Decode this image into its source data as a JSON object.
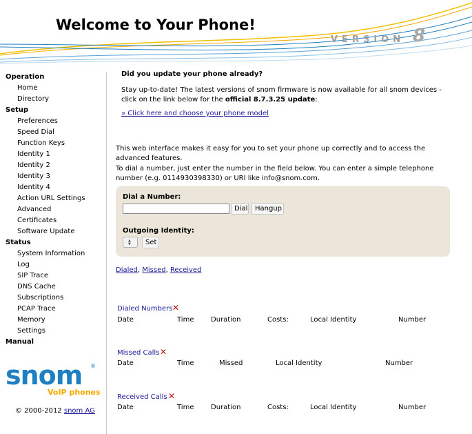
{
  "header": {
    "title": "Welcome to Your Phone!",
    "version_label": "VERSION",
    "version_number": "8"
  },
  "sidebar": {
    "sections": [
      {
        "label": "Operation",
        "items": [
          "Home",
          "Directory"
        ]
      },
      {
        "label": "Setup",
        "items": [
          "Preferences",
          "Speed Dial",
          "Function Keys",
          "Identity 1",
          "Identity 2",
          "Identity 3",
          "Identity 4",
          "Action URL Settings",
          "Advanced",
          "Certificates",
          "Software Update"
        ]
      },
      {
        "label": "Status",
        "items": [
          "System Information",
          "Log",
          "SIP Trace",
          "DNS Cache",
          "Subscriptions",
          "PCAP Trace",
          "Memory",
          "Settings"
        ]
      },
      {
        "label": "Manual",
        "items": []
      }
    ],
    "logo_text": "snom",
    "logo_reg": "®",
    "logo_subtitle": "VoIP phones",
    "copyright_prefix": "© 2000-2012 ",
    "copyright_link": "snom AG"
  },
  "update": {
    "title": "Did you update your phone already?",
    "text_prefix": "Stay up-to-date! The latest versions of snom firmware is now available for all snom devices - click on the link below for the ",
    "text_bold": "official 8.7.3.25 update",
    "text_suffix": ":",
    "link": "» Click here and choose your phone model"
  },
  "intro": {
    "line1": "This web interface makes it easy for you to set your phone up correctly and to access the advanced features.",
    "line2": "To dial a number, just enter the number in the field below. You can enter a simple telephone number (e.g. 0114930398330) or URI like info@snom.com."
  },
  "dial": {
    "label": "Dial a Number:",
    "input_value": "",
    "dial_button": "Dial",
    "hangup_button": "Hangup",
    "identity_label": "Outgoing Identity:",
    "set_button": "Set"
  },
  "filters": {
    "dialed": "Dialed",
    "missed": "Missed",
    "received": "Received",
    "separator": ", "
  },
  "calls": {
    "dialed": {
      "title": "Dialed Numbers",
      "columns": [
        "Date",
        "Time",
        "Duration",
        "Costs:",
        "Local Identity",
        "Number"
      ]
    },
    "missed": {
      "title": "Missed Calls",
      "columns": [
        "Date",
        "Time",
        "Missed",
        "Local Identity",
        "Number"
      ]
    },
    "received": {
      "title": "Received Calls",
      "columns": [
        "Date",
        "Time",
        "Duration",
        "Costs:",
        "Local Identity",
        "Number"
      ]
    }
  },
  "icons": {
    "delete": "close-icon",
    "delete_color": "#c01010",
    "brand_blue": "#1e7fc2",
    "brand_orange": "#f6a800"
  }
}
